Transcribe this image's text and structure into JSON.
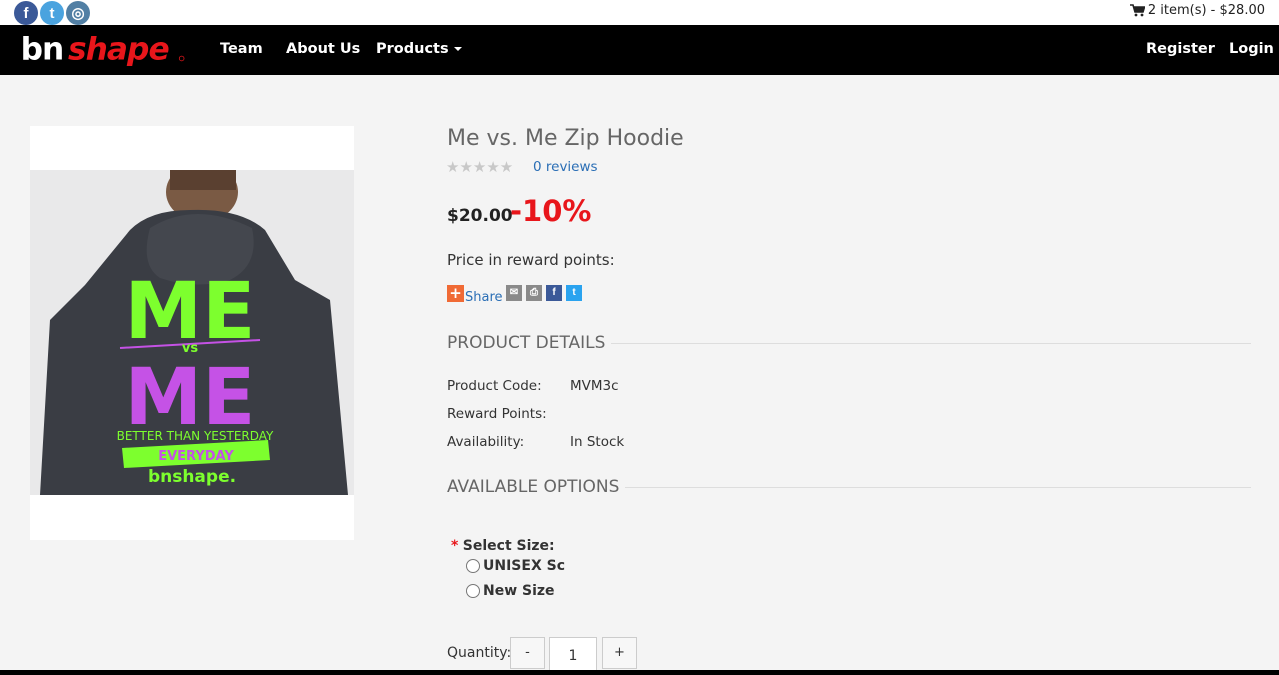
{
  "social": {
    "facebook_glyph": "f",
    "twitter_glyph": "t",
    "instagram_glyph": "◎"
  },
  "cart": {
    "summary": "2 item(s) - $28.00"
  },
  "nav": {
    "logo_text": "bnshape",
    "links": [
      "Team",
      "About Us",
      "Products"
    ],
    "register": "Register",
    "login": "Login"
  },
  "product": {
    "title": "Me vs. Me Zip Hoodie",
    "stars": "★★★★★",
    "rating": 0,
    "reviews": "0 reviews",
    "price": "$20.00",
    "discount": "-10%",
    "reward_price_label": "Price in reward points:",
    "share_label": "Share",
    "image_text": {
      "top": "ME",
      "vs": "vs",
      "bottom": "ME",
      "slogan": "BETTER THAN YESTERDAY",
      "banner": "EVERYDAY",
      "brand": "bnshape."
    }
  },
  "details": {
    "heading": "PRODUCT DETAILS",
    "rows": [
      {
        "label": "Product Code:",
        "value": "MVM3c"
      },
      {
        "label": "Reward Points:",
        "value": ""
      },
      {
        "label": "Availability:",
        "value": "In Stock"
      }
    ]
  },
  "options": {
    "heading": "AVAILABLE OPTIONS",
    "required_mark": "*",
    "size_label": "Select Size:",
    "sizes": [
      "UNISEX Sc",
      "New Size"
    ]
  },
  "quantity": {
    "label": "Quantity:",
    "minus": "-",
    "value": "1",
    "plus": "+"
  },
  "colors": {
    "brand_red": "#e8161b",
    "link_blue": "#2a6eb5",
    "navbar": "#000000",
    "print_green": "#7dff2e",
    "print_purple": "#c552e6"
  }
}
